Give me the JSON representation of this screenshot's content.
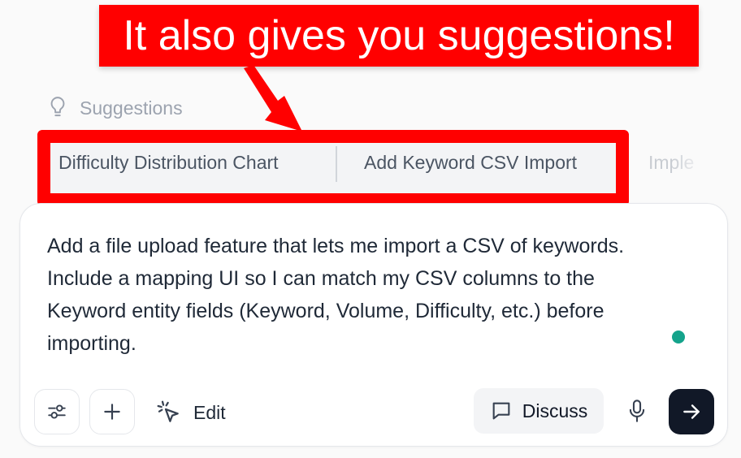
{
  "annotation": {
    "banner_text": "It also gives you suggestions!",
    "color": "#ff0000"
  },
  "suggestions": {
    "header_label": "Suggestions",
    "header_icon": "lightbulb-icon",
    "items": [
      {
        "label": "Difficulty Distribution Chart"
      },
      {
        "label": "Add Keyword CSV Import"
      },
      {
        "label": "Imple"
      }
    ]
  },
  "composer": {
    "text": "Add a file upload feature that lets me import a CSV of keywords. Include a mapping UI so I can match my CSV columns to the Keyword entity fields (Keyword, Volume, Difficulty, etc.) before importing.",
    "status_dot_color": "#14a38b"
  },
  "toolbar": {
    "settings_icon": "sliders-icon",
    "add_icon": "plus-icon",
    "edit_label": "Edit",
    "edit_icon": "cursor-click-icon",
    "discuss_label": "Discuss",
    "discuss_icon": "chat-bubble-icon",
    "mic_icon": "microphone-icon",
    "send_icon": "arrow-right-icon"
  }
}
